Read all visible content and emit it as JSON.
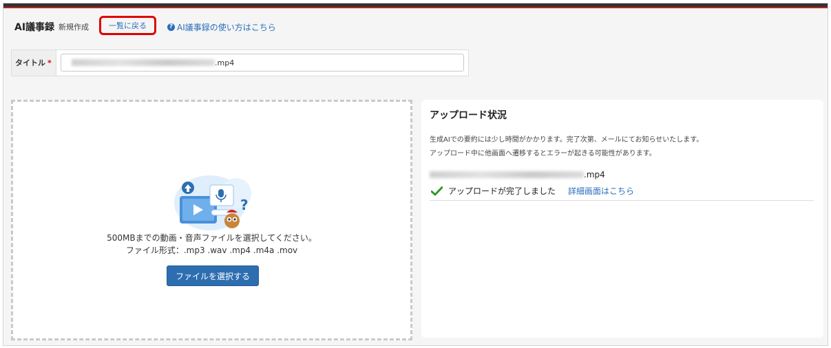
{
  "header": {
    "title": "AI議事録",
    "subtitle": "新規作成",
    "back_label": "一覧に戻る",
    "help_icon": "?",
    "help_label": "AI議事録の使い方はこちら"
  },
  "form": {
    "title_label": "タイトル",
    "required_mark": "*",
    "title_value_suffix": ".mp4"
  },
  "dropzone": {
    "line1": "500MBまでの動画・音声ファイルを選択してください。",
    "line2": "ファイル形式：.mp3 .wav .mp4 .m4a .mov",
    "button_label": "ファイルを選択する"
  },
  "status": {
    "title": "アップロード状況",
    "note1": "生成AIでの要約には少し時間がかかります。完了次第、メールにてお知らせいたします。",
    "note2": "アップロード中に他画面へ遷移するとエラーが起きる可能性があります。",
    "file_suffix": ".mp4",
    "complete_label": "アップロードが完了しました",
    "detail_link": "詳細画面はこちら"
  },
  "colors": {
    "accent_red": "#e10000",
    "link_blue": "#2a6ebb",
    "button_blue": "#2d6eb0",
    "success_green": "#2e9a2e"
  },
  "icons": [
    "help-icon",
    "upload-illustration",
    "check-icon"
  ]
}
